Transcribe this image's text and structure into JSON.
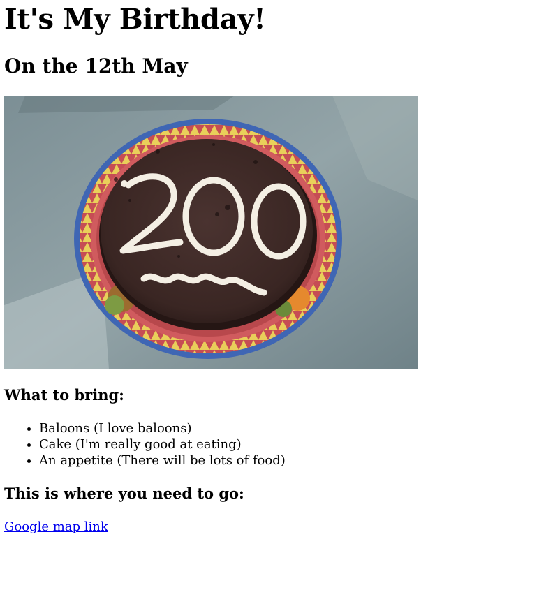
{
  "page": {
    "title": "It's My Birthday!",
    "subtitle": "On the 12th May",
    "image": {
      "description_icon": "birthday-cake-photo",
      "cake_text": "200"
    },
    "bring_heading": "What to bring:",
    "bring_items": [
      "Baloons (I love baloons)",
      "Cake (I'm really good at eating)",
      "An appetite (There will be lots of food)"
    ],
    "where_heading": "This is where you need to go:",
    "map_link_text": "Google map link"
  },
  "colors": {
    "link": "#0000ee",
    "text": "#000000",
    "background": "#ffffff"
  }
}
